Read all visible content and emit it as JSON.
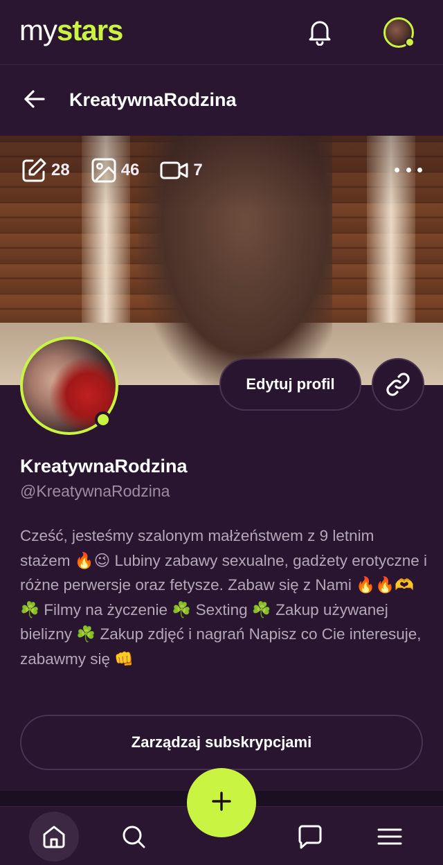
{
  "app": {
    "logo_my": "my",
    "logo_stars": "stars",
    "accent_color": "#c9f542",
    "background_color": "#2a1530"
  },
  "header": {
    "title": "KreatywnaRodzina"
  },
  "stats": {
    "posts": "28",
    "photos": "46",
    "videos": "7"
  },
  "profile": {
    "name": "KreatywnaRodzina",
    "handle": "@KreatywnaRodzina",
    "bio": "Cześć, jesteśmy szalonym małżeństwem z 9 letnim stażem 🔥😉 Lubiny zabawy sexualne, gadżety erotyczne i różne perwersje oraz fetysze. Zabaw się z Nami 🔥🔥🫶 ☘️ Filmy na życzenie ☘️ Sexting ☘️ Zakup używanej bielizny ☘️ Zakup zdjęć i nagrań Napisz co Cie interesuje, zabawmy się 👊",
    "edit_label": "Edytuj profil",
    "manage_label": "Zarządzaj subskrypcjami"
  },
  "icons": {
    "notifications": "bell-icon",
    "back": "arrow-left-icon",
    "posts": "edit-icon",
    "photos": "image-icon",
    "videos": "video-icon",
    "more": "more-horizontal-icon",
    "link": "link-icon",
    "home": "home-icon",
    "search": "search-icon",
    "create": "plus-icon",
    "messages": "message-icon",
    "menu": "menu-icon"
  }
}
